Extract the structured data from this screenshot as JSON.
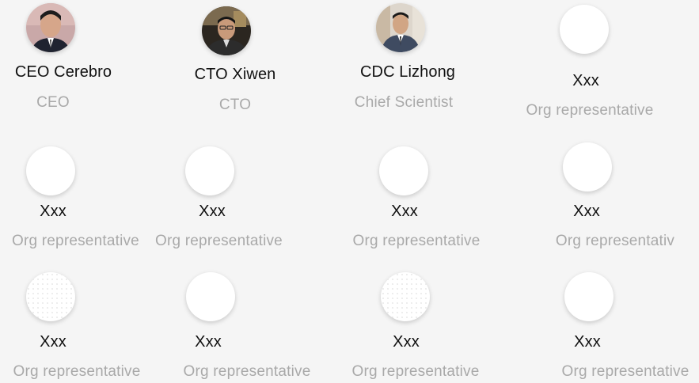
{
  "colors": {
    "background": "#f5f5f5",
    "name_text": "#111111",
    "role_text": "#a9a9a9",
    "avatar_placeholder": "#ffffff"
  },
  "members": [
    {
      "name": "CEO Cerebro",
      "role": "CEO",
      "avatar": "photo-ceo"
    },
    {
      "name": "CTO Xiwen",
      "role": "CTO",
      "avatar": "photo-cto"
    },
    {
      "name": "CDC Lizhong",
      "role": "Chief Scientist",
      "avatar": "photo-cdc"
    },
    {
      "name": "Xxx",
      "role": "Org representative",
      "avatar": "placeholder"
    },
    {
      "name": "Xxx",
      "role": "Org representative",
      "avatar": "placeholder"
    },
    {
      "name": "Xxx",
      "role": "Org representative",
      "avatar": "placeholder"
    },
    {
      "name": "Xxx",
      "role": "Org representative",
      "avatar": "placeholder"
    },
    {
      "name": "Xxx",
      "role": "Org representativ",
      "avatar": "placeholder"
    },
    {
      "name": "Xxx",
      "role": "Org representative",
      "avatar": "placeholder-dotted"
    },
    {
      "name": "Xxx",
      "role": "Org representative",
      "avatar": "placeholder"
    },
    {
      "name": "Xxx",
      "role": "Org representative",
      "avatar": "placeholder-dotted"
    },
    {
      "name": "Xxx",
      "role": "Org representative",
      "avatar": "placeholder"
    }
  ]
}
